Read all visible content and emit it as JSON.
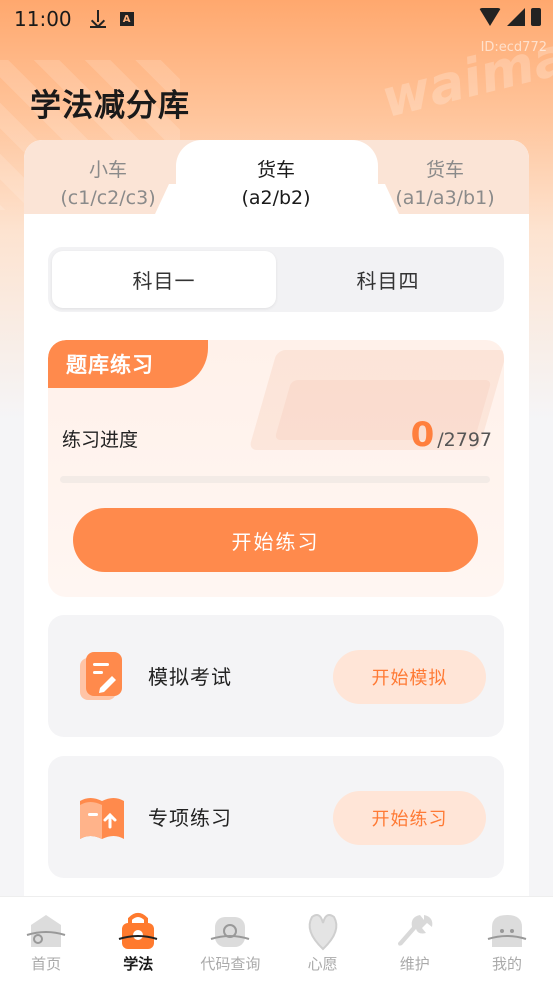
{
  "status_bar": {
    "time": "11:00"
  },
  "id_label": "ID:ecd772",
  "watermark": "waima",
  "page_title": "学法减分库",
  "vehicle_tabs": [
    {
      "line1": "小车",
      "line2": "(c1/c2/c3)",
      "active": false
    },
    {
      "line1": "货车",
      "line2": "(a2/b2)",
      "active": true
    },
    {
      "line1": "货车",
      "line2": "(a1/a3/b1)",
      "active": false
    }
  ],
  "subjects": [
    {
      "label": "科目一",
      "active": true
    },
    {
      "label": "科目四",
      "active": false
    }
  ],
  "practice": {
    "tag": "题库练习",
    "progress_label": "练习进度",
    "done": "0",
    "total": "/2797",
    "progress_fraction": 0,
    "start_label": "开始练习"
  },
  "mock_exam": {
    "label": "模拟考试",
    "button": "开始模拟",
    "icon": "exam-pen-icon"
  },
  "special_practice": {
    "label": "专项练习",
    "button": "开始练习",
    "icon": "book-upload-icon"
  },
  "bottom_nav": [
    {
      "label": "首页",
      "icon": "home-icon",
      "active": false
    },
    {
      "label": "学法",
      "icon": "study-icon",
      "active": true
    },
    {
      "label": "代码查询",
      "icon": "code-query-icon",
      "active": false
    },
    {
      "label": "心愿",
      "icon": "wish-icon",
      "active": false
    },
    {
      "label": "维护",
      "icon": "wrench-icon",
      "active": false
    },
    {
      "label": "我的",
      "icon": "profile-icon",
      "active": false
    }
  ],
  "colors": {
    "accent": "#ff8a4c",
    "accent_soft": "#ffe5d7",
    "tab_bg": "#fbe4d6"
  }
}
